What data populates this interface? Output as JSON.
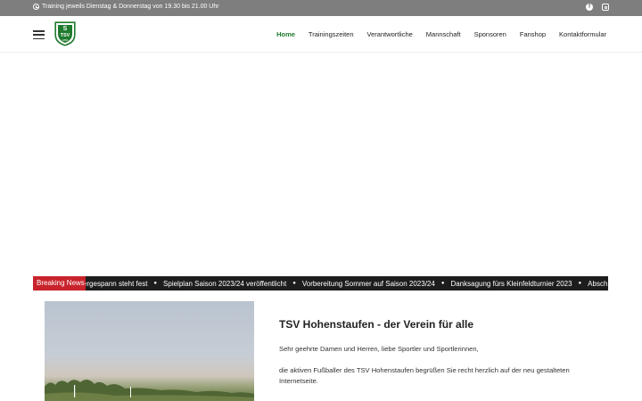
{
  "topbar": {
    "info_icon": "clock-icon",
    "info_text": "Training jeweils Dienstag & Donnerstag von 19.30 bis 21.00 Uhr",
    "social": [
      {
        "icon": "facebook-icon"
      },
      {
        "icon": "instagram-icon"
      }
    ]
  },
  "header": {
    "menu_icon": "hamburger-menu-icon",
    "logo_text": "TSV",
    "logo_year": "1884",
    "nav": [
      {
        "label": "Home",
        "active": true
      },
      {
        "label": "Trainingszeiten"
      },
      {
        "label": "Verantwortliche"
      },
      {
        "label": "Mannschaft"
      },
      {
        "label": "Sponsoren"
      },
      {
        "label": "Fanshop"
      },
      {
        "label": "Kontaktformular"
      }
    ]
  },
  "ticker": {
    "label": "Breaking News",
    "items": [
      "Trainergespann steht fest",
      "Spielplan Saison 2023/24 veröffentlicht",
      "Vorbereitung Sommer auf Saison 2023/24",
      "Danksagung fürs Kleinfeldturnier 2023",
      "Absch"
    ]
  },
  "article": {
    "title": "TSV Hohenstaufen - der Verein für alle",
    "paragraphs": [
      "Sehr geehrte Damen und Herren, liebe Sportler und Sportlerinnen,",
      "die aktiven Fußballer des TSV Hohenstaufen begrüßen Sie recht herzlich auf der neu gestalteten Internetseite."
    ]
  },
  "colors": {
    "topbar_bg": "#7e7e7e",
    "accent_green": "#1f7a2e",
    "ticker_bg": "#1d1d1d",
    "ticker_label_bg": "#c8232c"
  }
}
